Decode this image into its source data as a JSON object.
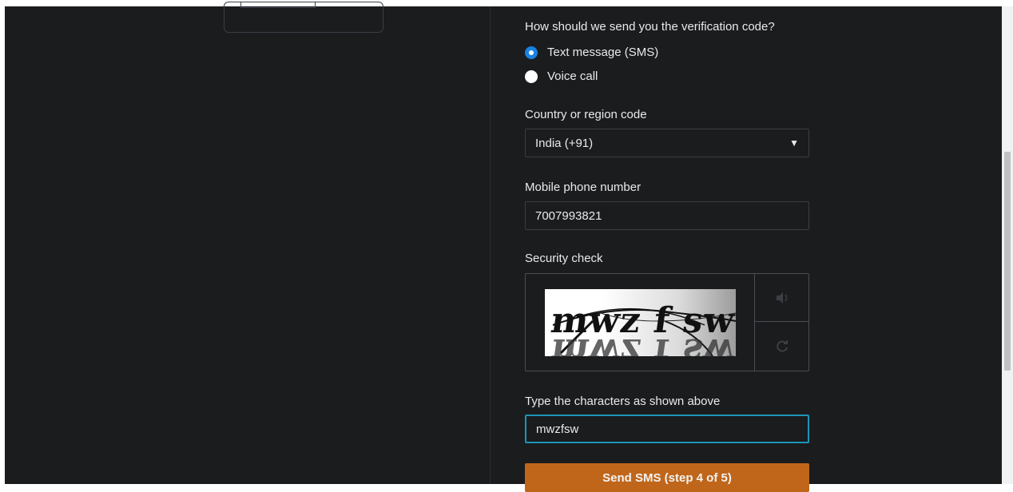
{
  "verification": {
    "question": "How should we send you the verification code?",
    "options": [
      {
        "label": "Text message (SMS)",
        "selected": true
      },
      {
        "label": "Voice call",
        "selected": false
      }
    ]
  },
  "country": {
    "label": "Country or region code",
    "value": "India (+91)"
  },
  "phone": {
    "label": "Mobile phone number",
    "value": "7007993821"
  },
  "security": {
    "label": "Security check",
    "captcha_text": "mwz f sw"
  },
  "captcha_input": {
    "label": "Type the characters as shown above",
    "value": "mwzfsw"
  },
  "submit": {
    "label": "Send SMS (step 4 of 5)"
  },
  "colors": {
    "background": "#1b1c1e",
    "accent_button": "#c0661a",
    "radio_selected": "#1a82e2",
    "focus_border": "#1c95b8"
  },
  "icons": {
    "audio": "speaker-icon",
    "refresh": "refresh-icon",
    "dropdown": "triangle-down-icon"
  }
}
